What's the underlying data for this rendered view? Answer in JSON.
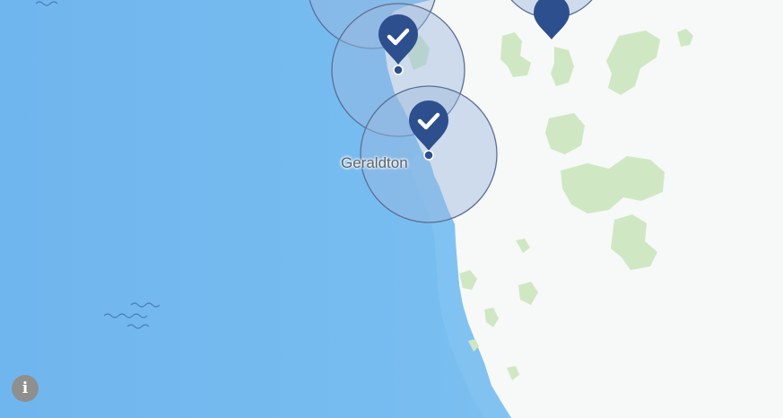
{
  "map": {
    "place_labels": [
      {
        "name": "Geraldton"
      }
    ],
    "markers": [
      {
        "id": "marker-north-partial",
        "status": "checked",
        "icon": "check-icon",
        "partial": true
      },
      {
        "id": "marker-north",
        "status": "checked",
        "icon": "check-icon"
      },
      {
        "id": "marker-geraldton",
        "status": "checked",
        "icon": "check-icon"
      }
    ],
    "colors": {
      "ocean": "#6cb4ee",
      "ocean_shallow": "#8ecaf4",
      "land": "#f7f8f8",
      "vegetation": "#cfe8c3",
      "marker": "#2d4f8e",
      "coverage_fill": "#9bb9dd",
      "coverage_stroke": "#5c6f93"
    },
    "controls": {
      "info_icon": "info-icon",
      "info_glyph": "i"
    }
  }
}
